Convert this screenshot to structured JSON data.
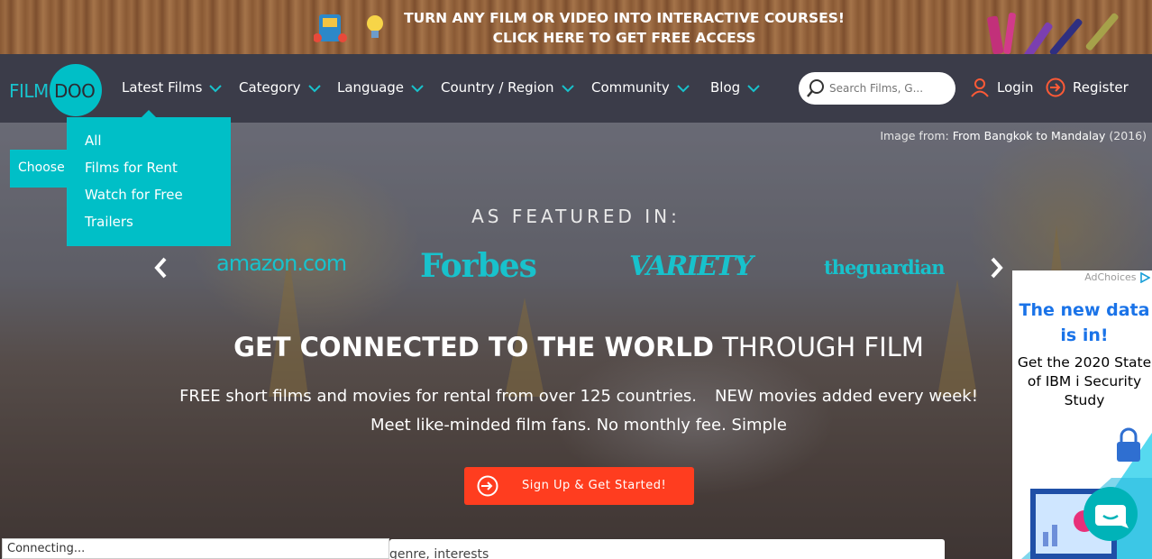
{
  "promo": {
    "line1": "TURN ANY FILM OR VIDEO INTO INTERACTIVE COURSES!",
    "line2": "CLICK HERE TO GET FREE ACCESS"
  },
  "brand": {
    "part1": "FILM",
    "part2": "DOO",
    "accent": "#00bfc7"
  },
  "nav": {
    "items": [
      {
        "label": "Latest Films"
      },
      {
        "label": "Category"
      },
      {
        "label": "Language"
      },
      {
        "label": "Country / Region"
      },
      {
        "label": "Community"
      },
      {
        "label": "Blog"
      }
    ],
    "search_placeholder": "Search Films, G...",
    "login": "Login",
    "register": "Register"
  },
  "dropdown": {
    "items": [
      "All",
      "Films for Rent",
      "Watch for Free",
      "Trailers"
    ]
  },
  "hero": {
    "credit_prefix": "Image from:",
    "credit_title": "From Bangkok to Mandalay",
    "credit_year": "(2016)",
    "choose": "Choose",
    "featured": "AS FEATURED IN:",
    "press": [
      "amazon.com",
      "Forbes",
      "VARIETY",
      "theguardian"
    ],
    "headline_bold": "GET CONNECTED TO THE WORLD",
    "headline_light": "THROUGH FILM",
    "sub1a": "FREE short films and movies for rental from over 125 countries.",
    "sub1b": "NEW movies added every week!",
    "sub2": "Meet like-minded film fans. No monthly fee. Simple",
    "signup": "Sign Up & Get Started!",
    "genre_text": "genre, interests"
  },
  "ad": {
    "adchoices": "AdChoices",
    "title": "The new data is in!",
    "body": "Get the 2020 State of IBM i Security Study"
  },
  "status": "Connecting..."
}
